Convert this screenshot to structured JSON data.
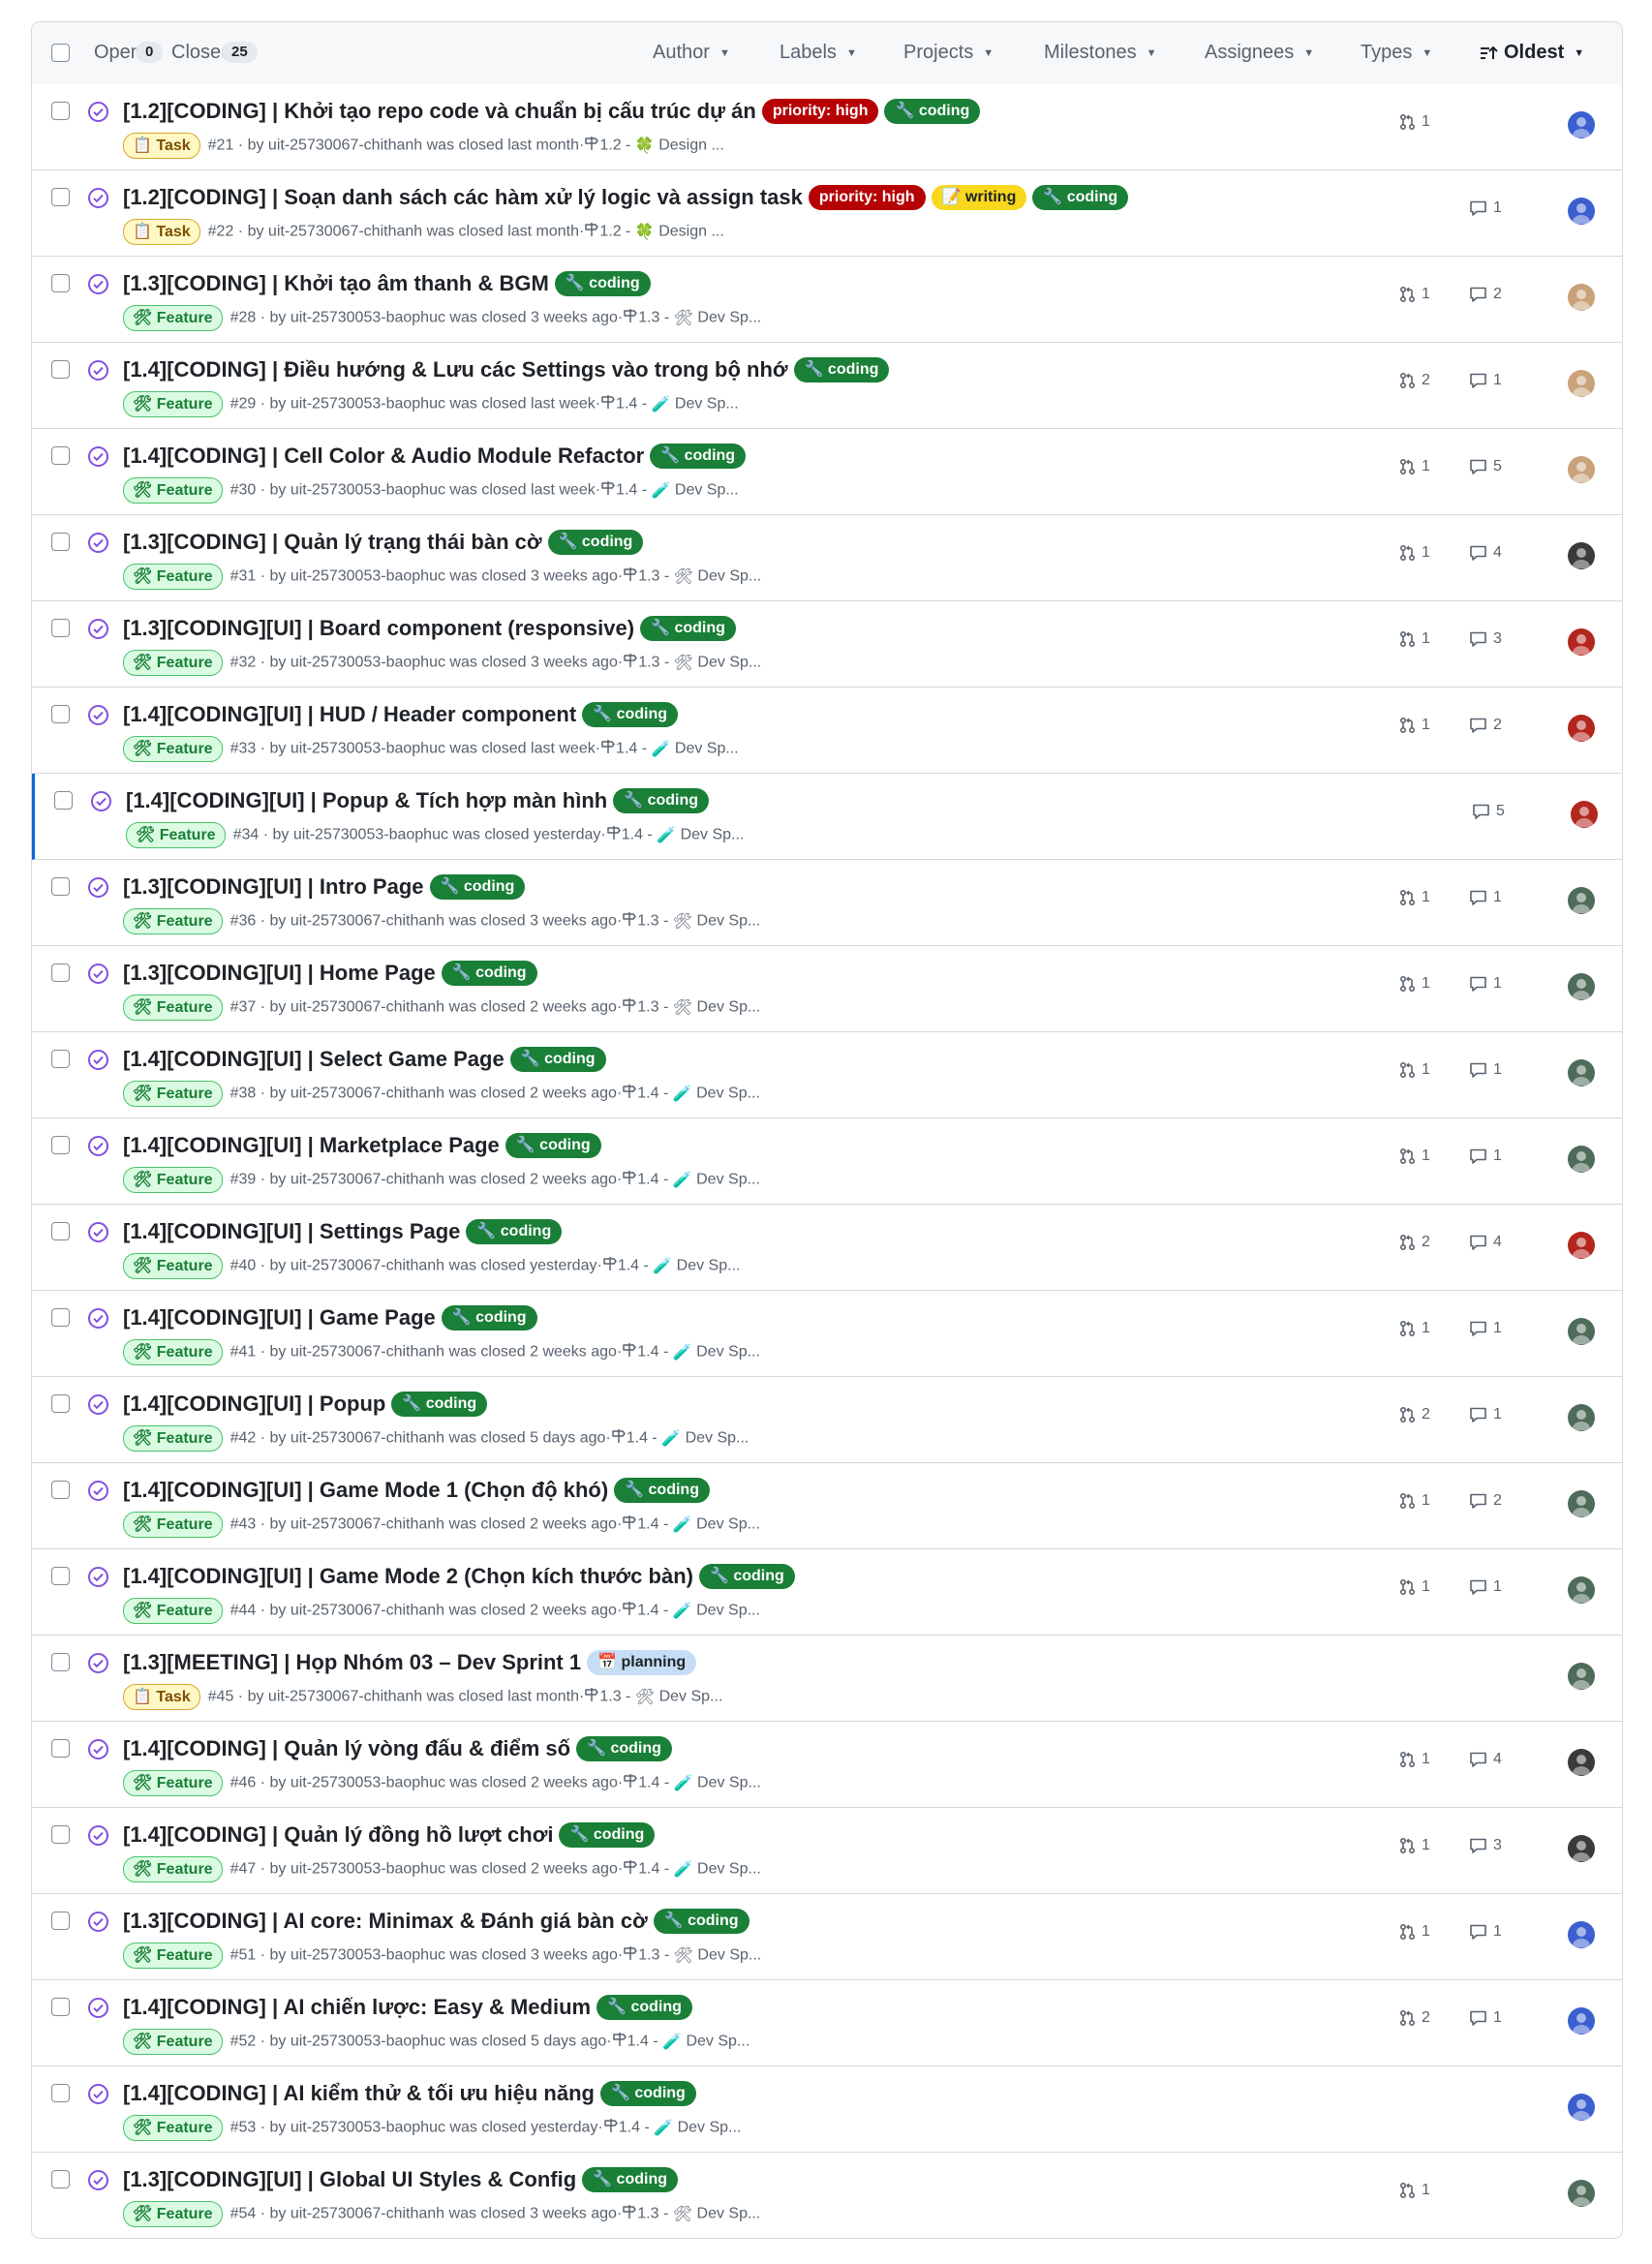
{
  "toolbar": {
    "open_label": "Open",
    "open_count": "0",
    "closed_label": "Closed",
    "closed_count": "25",
    "filters": [
      "Author",
      "Labels",
      "Projects",
      "Milestones",
      "Assignees",
      "Types"
    ],
    "sort_label": "Oldest"
  },
  "colors": {
    "closed_state": "#8250df",
    "link_text": "#1f2328",
    "muted": "#59636e",
    "border": "#d1d9e0"
  },
  "label_styles": {
    "priority": {
      "text": "priority: high",
      "bg": "#b60205",
      "fg": "#ffffff",
      "icon": ""
    },
    "coding": {
      "text": "coding",
      "bg": "#1a7f37",
      "fg": "#ffffff",
      "icon": "🔧"
    },
    "writing": {
      "text": "writing",
      "bg": "#f9d71c",
      "fg": "#1f2328",
      "icon": "📝"
    },
    "planning": {
      "text": "planning",
      "bg": "#c5def5",
      "fg": "#1f2328",
      "icon": "📅"
    }
  },
  "type_icons": {
    "Task": "📋",
    "Feature": "🛠"
  },
  "issues": [
    {
      "title": "[1.2][CODING] | Khởi tạo repo code và chuẩn bị cấu trúc dự án",
      "labels": [
        "priority",
        "coding"
      ],
      "type": "Task",
      "number": "#21",
      "author": "uit-25730067-chithanh",
      "closed": "was closed last month",
      "milestone": "1.2",
      "project_icon": "🍀",
      "project": "Design ...",
      "prs": "1",
      "comments": "",
      "avatar": "#3c5fcf"
    },
    {
      "title": "[1.2][CODING] | Soạn danh sách các hàm xử lý logic và assign task",
      "labels": [
        "priority",
        "writing",
        "coding"
      ],
      "type": "Task",
      "number": "#22",
      "author": "uit-25730067-chithanh",
      "closed": "was closed last month",
      "milestone": "1.2",
      "project_icon": "🍀",
      "project": "Design ...",
      "prs": "",
      "comments": "1",
      "avatar": "#3c5fcf"
    },
    {
      "title": "[1.3][CODING] | Khởi tạo âm thanh & BGM",
      "labels": [
        "coding"
      ],
      "type": "Feature",
      "number": "#28",
      "author": "uit-25730053-baophuc",
      "closed": "was closed 3 weeks ago",
      "milestone": "1.3",
      "project_icon": "🛠",
      "project": "Dev Sp...",
      "prs": "1",
      "comments": "2",
      "avatar": "#c9a27a"
    },
    {
      "title": "[1.4][CODING] | Điều hướng & Lưu các Settings vào trong bộ nhớ",
      "labels": [
        "coding"
      ],
      "type": "Feature",
      "number": "#29",
      "author": "uit-25730053-baophuc",
      "closed": "was closed last week",
      "milestone": "1.4",
      "project_icon": "🧪",
      "project": "Dev Sp...",
      "prs": "2",
      "comments": "1",
      "avatar": "#c9a27a"
    },
    {
      "title": "[1.4][CODING] | Cell Color & Audio Module Refactor",
      "labels": [
        "coding"
      ],
      "type": "Feature",
      "number": "#30",
      "author": "uit-25730053-baophuc",
      "closed": "was closed last week",
      "milestone": "1.4",
      "project_icon": "🧪",
      "project": "Dev Sp...",
      "prs": "1",
      "comments": "5",
      "avatar": "#c9a27a"
    },
    {
      "title": "[1.3][CODING] | Quản lý trạng thái bàn cờ",
      "labels": [
        "coding"
      ],
      "type": "Feature",
      "number": "#31",
      "author": "uit-25730053-baophuc",
      "closed": "was closed 3 weeks ago",
      "milestone": "1.3",
      "project_icon": "🛠",
      "project": "Dev Sp...",
      "prs": "1",
      "comments": "4",
      "avatar": "#3a3a3a"
    },
    {
      "title": "[1.3][CODING][UI] | Board component (responsive)",
      "labels": [
        "coding"
      ],
      "type": "Feature",
      "number": "#32",
      "author": "uit-25730053-baophuc",
      "closed": "was closed 3 weeks ago",
      "milestone": "1.3",
      "project_icon": "🛠",
      "project": "Dev Sp...",
      "prs": "1",
      "comments": "3",
      "avatar": "#b3261e"
    },
    {
      "title": "[1.4][CODING][UI] | HUD / Header component",
      "labels": [
        "coding"
      ],
      "type": "Feature",
      "number": "#33",
      "author": "uit-25730053-baophuc",
      "closed": "was closed last week",
      "milestone": "1.4",
      "project_icon": "🧪",
      "project": "Dev Sp...",
      "prs": "1",
      "comments": "2",
      "avatar": "#b3261e"
    },
    {
      "title": "[1.4][CODING][UI] | Popup & Tích hợp màn hình",
      "labels": [
        "coding"
      ],
      "type": "Feature",
      "number": "#34",
      "author": "uit-25730053-baophuc",
      "closed": "was closed yesterday",
      "milestone": "1.4",
      "project_icon": "🧪",
      "project": "Dev Sp...",
      "prs": "",
      "comments": "5",
      "avatar": "#b3261e",
      "highlight": true
    },
    {
      "title": "[1.3][CODING][UI] | Intro Page",
      "labels": [
        "coding"
      ],
      "type": "Feature",
      "number": "#36",
      "author": "uit-25730067-chithanh",
      "closed": "was closed 3 weeks ago",
      "milestone": "1.3",
      "project_icon": "🛠",
      "project": "Dev Sp...",
      "prs": "1",
      "comments": "1",
      "avatar": "#4f6b5a"
    },
    {
      "title": "[1.3][CODING][UI] | Home Page",
      "labels": [
        "coding"
      ],
      "type": "Feature",
      "number": "#37",
      "author": "uit-25730067-chithanh",
      "closed": "was closed 2 weeks ago",
      "milestone": "1.3",
      "project_icon": "🛠",
      "project": "Dev Sp...",
      "prs": "1",
      "comments": "1",
      "avatar": "#4f6b5a"
    },
    {
      "title": "[1.4][CODING][UI] | Select Game Page",
      "labels": [
        "coding"
      ],
      "type": "Feature",
      "number": "#38",
      "author": "uit-25730067-chithanh",
      "closed": "was closed 2 weeks ago",
      "milestone": "1.4",
      "project_icon": "🧪",
      "project": "Dev Sp...",
      "prs": "1",
      "comments": "1",
      "avatar": "#4f6b5a"
    },
    {
      "title": "[1.4][CODING][UI] | Marketplace Page",
      "labels": [
        "coding"
      ],
      "type": "Feature",
      "number": "#39",
      "author": "uit-25730067-chithanh",
      "closed": "was closed 2 weeks ago",
      "milestone": "1.4",
      "project_icon": "🧪",
      "project": "Dev Sp...",
      "prs": "1",
      "comments": "1",
      "avatar": "#4f6b5a"
    },
    {
      "title": "[1.4][CODING][UI] | Settings Page",
      "labels": [
        "coding"
      ],
      "type": "Feature",
      "number": "#40",
      "author": "uit-25730067-chithanh",
      "closed": "was closed yesterday",
      "milestone": "1.4",
      "project_icon": "🧪",
      "project": "Dev Sp...",
      "prs": "2",
      "comments": "4",
      "avatar": "#b3261e"
    },
    {
      "title": "[1.4][CODING][UI] | Game Page",
      "labels": [
        "coding"
      ],
      "type": "Feature",
      "number": "#41",
      "author": "uit-25730067-chithanh",
      "closed": "was closed 2 weeks ago",
      "milestone": "1.4",
      "project_icon": "🧪",
      "project": "Dev Sp...",
      "prs": "1",
      "comments": "1",
      "avatar": "#4f6b5a"
    },
    {
      "title": "[1.4][CODING][UI] | Popup",
      "labels": [
        "coding"
      ],
      "type": "Feature",
      "number": "#42",
      "author": "uit-25730067-chithanh",
      "closed": "was closed 5 days ago",
      "milestone": "1.4",
      "project_icon": "🧪",
      "project": "Dev Sp...",
      "prs": "2",
      "comments": "1",
      "avatar": "#4f6b5a"
    },
    {
      "title": "[1.4][CODING][UI] | Game Mode 1 (Chọn độ khó)",
      "labels": [
        "coding"
      ],
      "type": "Feature",
      "number": "#43",
      "author": "uit-25730067-chithanh",
      "closed": "was closed 2 weeks ago",
      "milestone": "1.4",
      "project_icon": "🧪",
      "project": "Dev Sp...",
      "prs": "1",
      "comments": "2",
      "avatar": "#4f6b5a"
    },
    {
      "title": "[1.4][CODING][UI] | Game Mode 2 (Chọn kích thước bàn)",
      "labels": [
        "coding"
      ],
      "type": "Feature",
      "number": "#44",
      "author": "uit-25730067-chithanh",
      "closed": "was closed 2 weeks ago",
      "milestone": "1.4",
      "project_icon": "🧪",
      "project": "Dev Sp...",
      "prs": "1",
      "comments": "1",
      "avatar": "#4f6b5a"
    },
    {
      "title": "[1.3][MEETING] | Họp Nhóm 03 – Dev Sprint 1",
      "labels": [
        "planning"
      ],
      "type": "Task",
      "number": "#45",
      "author": "uit-25730067-chithanh",
      "closed": "was closed last month",
      "milestone": "1.3",
      "project_icon": "🛠",
      "project": "Dev Sp...",
      "prs": "",
      "comments": "",
      "avatar": "#4f6b5a"
    },
    {
      "title": "[1.4][CODING] | Quản lý vòng đấu & điểm số",
      "labels": [
        "coding"
      ],
      "type": "Feature",
      "number": "#46",
      "author": "uit-25730053-baophuc",
      "closed": "was closed 2 weeks ago",
      "milestone": "1.4",
      "project_icon": "🧪",
      "project": "Dev Sp...",
      "prs": "1",
      "comments": "4",
      "avatar": "#3a3a3a"
    },
    {
      "title": "[1.4][CODING] | Quản lý đồng hồ lượt chơi",
      "labels": [
        "coding"
      ],
      "type": "Feature",
      "number": "#47",
      "author": "uit-25730053-baophuc",
      "closed": "was closed 2 weeks ago",
      "milestone": "1.4",
      "project_icon": "🧪",
      "project": "Dev Sp...",
      "prs": "1",
      "comments": "3",
      "avatar": "#3a3a3a"
    },
    {
      "title": "[1.3][CODING] | AI core: Minimax & Đánh giá bàn cờ",
      "labels": [
        "coding"
      ],
      "type": "Feature",
      "number": "#51",
      "author": "uit-25730053-baophuc",
      "closed": "was closed 3 weeks ago",
      "milestone": "1.3",
      "project_icon": "🛠",
      "project": "Dev Sp...",
      "prs": "1",
      "comments": "1",
      "avatar": "#3c5fcf"
    },
    {
      "title": "[1.4][CODING] | AI chiến lược: Easy & Medium",
      "labels": [
        "coding"
      ],
      "type": "Feature",
      "number": "#52",
      "author": "uit-25730053-baophuc",
      "closed": "was closed 5 days ago",
      "milestone": "1.4",
      "project_icon": "🧪",
      "project": "Dev Sp...",
      "prs": "2",
      "comments": "1",
      "avatar": "#3c5fcf"
    },
    {
      "title": "[1.4][CODING] | AI kiểm thử & tối ưu hiệu năng",
      "labels": [
        "coding"
      ],
      "type": "Feature",
      "number": "#53",
      "author": "uit-25730053-baophuc",
      "closed": "was closed yesterday",
      "milestone": "1.4",
      "project_icon": "🧪",
      "project": "Dev Sp...",
      "prs": "",
      "comments": "",
      "avatar": "#3c5fcf"
    },
    {
      "title": "[1.3][CODING][UI] | Global UI Styles & Config",
      "labels": [
        "coding"
      ],
      "type": "Feature",
      "number": "#54",
      "author": "uit-25730067-chithanh",
      "closed": "was closed 3 weeks ago",
      "milestone": "1.3",
      "project_icon": "🛠",
      "project": "Dev Sp...",
      "prs": "1",
      "comments": "",
      "avatar": "#4f6b5a"
    }
  ]
}
